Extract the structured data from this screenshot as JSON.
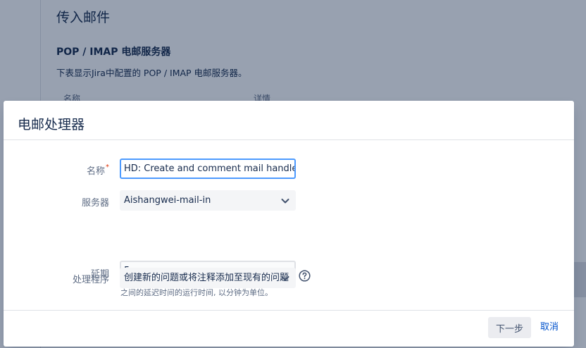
{
  "background": {
    "page_title": "传入邮件",
    "section_heading": "POP / IMAP 电邮服务器",
    "section_description": "下表显示Jira中配置的 POP / IMAP 电邮服务器。",
    "columns": [
      "名称",
      "详情"
    ]
  },
  "dialog": {
    "title": "电邮处理器",
    "fields": {
      "name": {
        "label": "名称",
        "required_marker": "*",
        "value": "HD: Create and comment mail handler"
      },
      "server": {
        "label": "服务器",
        "selected": "Aishangwei-mail-in"
      },
      "delay": {
        "label": "延期",
        "value": "5",
        "hint": "之间的延迟时间的运行时间, 以分钟为单位。"
      },
      "handler": {
        "label": "处理程序",
        "selected": "创建新的问题或将注释添加至现有的问题",
        "help_icon": "question-circle-icon"
      }
    },
    "buttons": {
      "next": "下一步",
      "cancel": "取消"
    }
  },
  "colors": {
    "accent": "#0052cc",
    "focus": "#4c9aff",
    "required": "#de350b",
    "overlay": "#091e42"
  }
}
